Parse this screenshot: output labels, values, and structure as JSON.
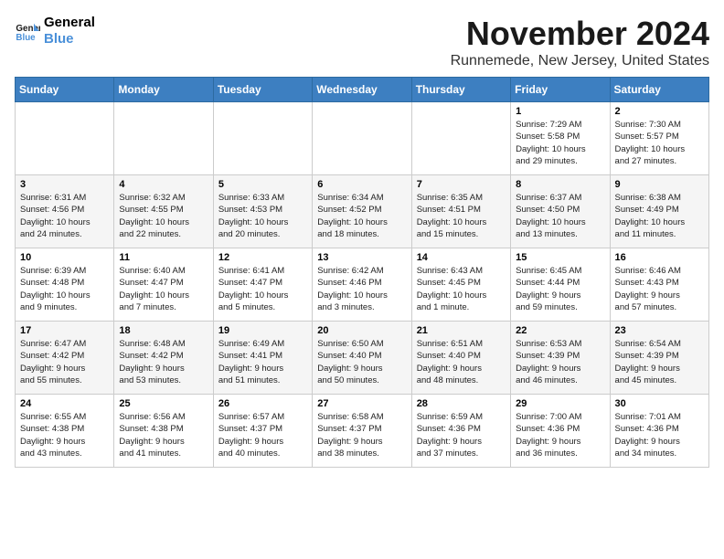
{
  "logo": {
    "line1": "General",
    "line2": "Blue"
  },
  "title": "November 2024",
  "location": "Runnemede, New Jersey, United States",
  "weekdays": [
    "Sunday",
    "Monday",
    "Tuesday",
    "Wednesday",
    "Thursday",
    "Friday",
    "Saturday"
  ],
  "weeks": [
    [
      {
        "day": "",
        "info": ""
      },
      {
        "day": "",
        "info": ""
      },
      {
        "day": "",
        "info": ""
      },
      {
        "day": "",
        "info": ""
      },
      {
        "day": "",
        "info": ""
      },
      {
        "day": "1",
        "info": "Sunrise: 7:29 AM\nSunset: 5:58 PM\nDaylight: 10 hours\nand 29 minutes."
      },
      {
        "day": "2",
        "info": "Sunrise: 7:30 AM\nSunset: 5:57 PM\nDaylight: 10 hours\nand 27 minutes."
      }
    ],
    [
      {
        "day": "3",
        "info": "Sunrise: 6:31 AM\nSunset: 4:56 PM\nDaylight: 10 hours\nand 24 minutes."
      },
      {
        "day": "4",
        "info": "Sunrise: 6:32 AM\nSunset: 4:55 PM\nDaylight: 10 hours\nand 22 minutes."
      },
      {
        "day": "5",
        "info": "Sunrise: 6:33 AM\nSunset: 4:53 PM\nDaylight: 10 hours\nand 20 minutes."
      },
      {
        "day": "6",
        "info": "Sunrise: 6:34 AM\nSunset: 4:52 PM\nDaylight: 10 hours\nand 18 minutes."
      },
      {
        "day": "7",
        "info": "Sunrise: 6:35 AM\nSunset: 4:51 PM\nDaylight: 10 hours\nand 15 minutes."
      },
      {
        "day": "8",
        "info": "Sunrise: 6:37 AM\nSunset: 4:50 PM\nDaylight: 10 hours\nand 13 minutes."
      },
      {
        "day": "9",
        "info": "Sunrise: 6:38 AM\nSunset: 4:49 PM\nDaylight: 10 hours\nand 11 minutes."
      }
    ],
    [
      {
        "day": "10",
        "info": "Sunrise: 6:39 AM\nSunset: 4:48 PM\nDaylight: 10 hours\nand 9 minutes."
      },
      {
        "day": "11",
        "info": "Sunrise: 6:40 AM\nSunset: 4:47 PM\nDaylight: 10 hours\nand 7 minutes."
      },
      {
        "day": "12",
        "info": "Sunrise: 6:41 AM\nSunset: 4:47 PM\nDaylight: 10 hours\nand 5 minutes."
      },
      {
        "day": "13",
        "info": "Sunrise: 6:42 AM\nSunset: 4:46 PM\nDaylight: 10 hours\nand 3 minutes."
      },
      {
        "day": "14",
        "info": "Sunrise: 6:43 AM\nSunset: 4:45 PM\nDaylight: 10 hours\nand 1 minute."
      },
      {
        "day": "15",
        "info": "Sunrise: 6:45 AM\nSunset: 4:44 PM\nDaylight: 9 hours\nand 59 minutes."
      },
      {
        "day": "16",
        "info": "Sunrise: 6:46 AM\nSunset: 4:43 PM\nDaylight: 9 hours\nand 57 minutes."
      }
    ],
    [
      {
        "day": "17",
        "info": "Sunrise: 6:47 AM\nSunset: 4:42 PM\nDaylight: 9 hours\nand 55 minutes."
      },
      {
        "day": "18",
        "info": "Sunrise: 6:48 AM\nSunset: 4:42 PM\nDaylight: 9 hours\nand 53 minutes."
      },
      {
        "day": "19",
        "info": "Sunrise: 6:49 AM\nSunset: 4:41 PM\nDaylight: 9 hours\nand 51 minutes."
      },
      {
        "day": "20",
        "info": "Sunrise: 6:50 AM\nSunset: 4:40 PM\nDaylight: 9 hours\nand 50 minutes."
      },
      {
        "day": "21",
        "info": "Sunrise: 6:51 AM\nSunset: 4:40 PM\nDaylight: 9 hours\nand 48 minutes."
      },
      {
        "day": "22",
        "info": "Sunrise: 6:53 AM\nSunset: 4:39 PM\nDaylight: 9 hours\nand 46 minutes."
      },
      {
        "day": "23",
        "info": "Sunrise: 6:54 AM\nSunset: 4:39 PM\nDaylight: 9 hours\nand 45 minutes."
      }
    ],
    [
      {
        "day": "24",
        "info": "Sunrise: 6:55 AM\nSunset: 4:38 PM\nDaylight: 9 hours\nand 43 minutes."
      },
      {
        "day": "25",
        "info": "Sunrise: 6:56 AM\nSunset: 4:38 PM\nDaylight: 9 hours\nand 41 minutes."
      },
      {
        "day": "26",
        "info": "Sunrise: 6:57 AM\nSunset: 4:37 PM\nDaylight: 9 hours\nand 40 minutes."
      },
      {
        "day": "27",
        "info": "Sunrise: 6:58 AM\nSunset: 4:37 PM\nDaylight: 9 hours\nand 38 minutes."
      },
      {
        "day": "28",
        "info": "Sunrise: 6:59 AM\nSunset: 4:36 PM\nDaylight: 9 hours\nand 37 minutes."
      },
      {
        "day": "29",
        "info": "Sunrise: 7:00 AM\nSunset: 4:36 PM\nDaylight: 9 hours\nand 36 minutes."
      },
      {
        "day": "30",
        "info": "Sunrise: 7:01 AM\nSunset: 4:36 PM\nDaylight: 9 hours\nand 34 minutes."
      }
    ]
  ]
}
